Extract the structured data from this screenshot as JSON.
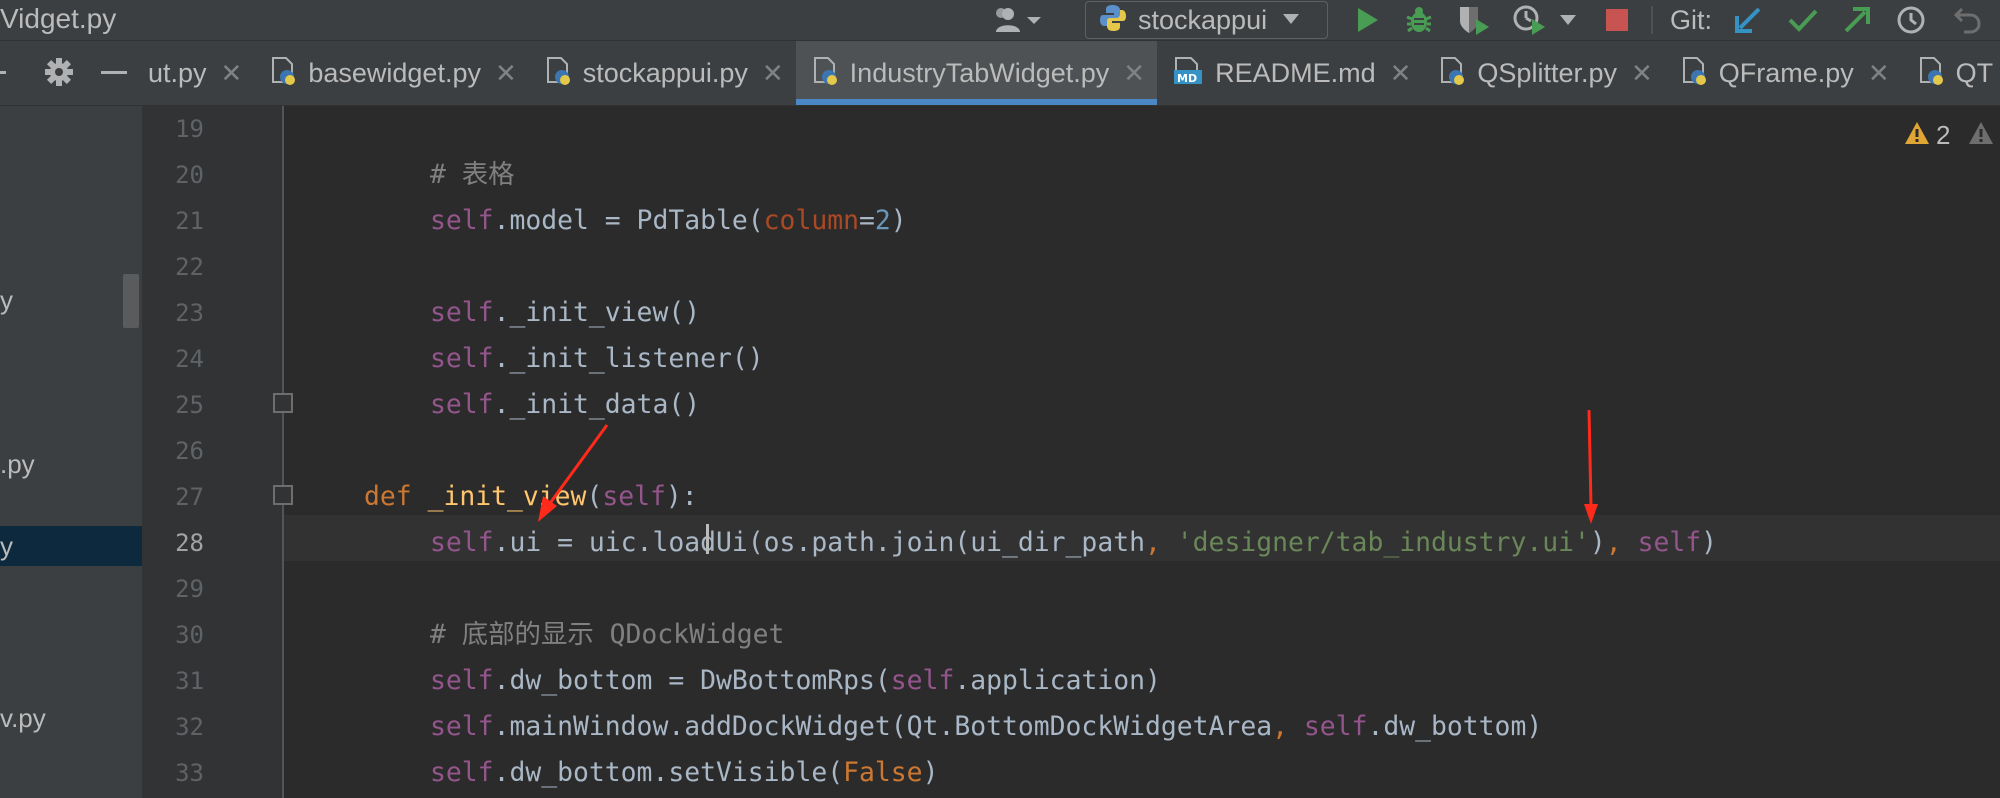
{
  "window": {
    "title": "Vidget.py"
  },
  "toolbar": {
    "run_config": "stockappui",
    "git_label": "Git:"
  },
  "tabs": [
    {
      "label": "ut.py",
      "icon": "python-file-icon",
      "active": false
    },
    {
      "label": "basewidget.py",
      "icon": "python-file-icon",
      "active": false
    },
    {
      "label": "stockappui.py",
      "icon": "python-file-icon",
      "active": false
    },
    {
      "label": "IndustryTabWidget.py",
      "icon": "python-file-icon",
      "active": true
    },
    {
      "label": "README.md",
      "icon": "markdown-file-icon",
      "active": false
    },
    {
      "label": "QSplitter.py",
      "icon": "python-file-icon",
      "active": false
    },
    {
      "label": "QFrame.py",
      "icon": "python-file-icon",
      "active": false
    },
    {
      "label": "QT",
      "icon": "python-file-icon",
      "active": false
    }
  ],
  "project_panel": {
    "items": [
      {
        "label": "y",
        "selected": false
      },
      {
        "label": ".py",
        "selected": false
      },
      {
        "label": "y",
        "selected": true
      },
      {
        "label": "v.py",
        "selected": false
      }
    ]
  },
  "editor": {
    "warning_count": "2",
    "current_line": "28",
    "line_numbers": [
      "19",
      "20",
      "21",
      "22",
      "23",
      "24",
      "25",
      "26",
      "27",
      "28",
      "29",
      "30",
      "31",
      "32",
      "33"
    ],
    "code": {
      "l20_comment": "# 表格",
      "l21_self": "self",
      "l21_a": ".model = PdTable(",
      "l21_param": "column",
      "l21_eq": "=",
      "l21_num": "2",
      "l21_b": ")",
      "l23_self": "self",
      "l23_a": "._init_view()",
      "l24_self": "self",
      "l24_a": "._init_listener()",
      "l25_self": "self",
      "l25_a": "._init_data()",
      "l27_def": "def",
      "l27_func": "_init_view",
      "l27_a": "(",
      "l27_self": "self",
      "l27_b": "):",
      "l28_self": "self",
      "l28_a": ".ui = uic.loadUi(os.path.join(ui_dir_path",
      "l28_comma1": ",",
      "l28_str": "'designer/tab_industry.ui'",
      "l28_b": ")",
      "l28_comma2": ",",
      "l28_self2": "self",
      "l28_c": ")",
      "l30_comment": "# 底部的显示 QDockWidget",
      "l31_self": "self",
      "l31_a": ".dw_bottom = DwBottomRps(",
      "l31_self2": "self",
      "l31_b": ".application)",
      "l32_self": "self",
      "l32_a": ".mainWindow.addDockWidget(Qt.BottomDockWidgetArea",
      "l32_comma": ",",
      "l32_self2": "self",
      "l32_b": ".dw_bottom)",
      "l33_self": "self",
      "l33_a": ".dw_bottom.setVisible(",
      "l33_false": "False",
      "l33_b": ")"
    }
  },
  "colors": {
    "accent": "#4a88c7",
    "run_green": "#499c54",
    "stop_red": "#c75450",
    "annotation_red": "#ff2a1a"
  }
}
